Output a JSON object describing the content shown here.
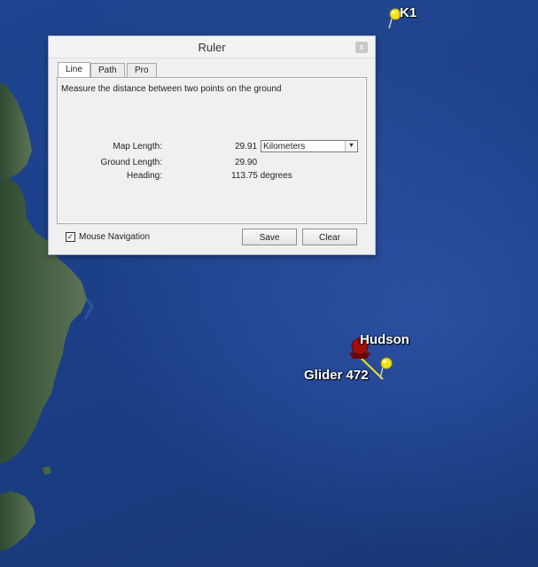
{
  "map": {
    "placemarks": [
      {
        "name": "K1",
        "icon": "yellow-pushpin-icon"
      },
      {
        "name": "Hudson",
        "icon": "red-ship-icon"
      },
      {
        "name": "Glider 472",
        "icon": "yellow-pushpin-icon"
      }
    ],
    "colors": {
      "ocean": "#1c3f88",
      "land": "#3c5a3a",
      "pin": "#f2e21a",
      "ship": "#a30f0f",
      "ruler_line": "#f2e21a"
    }
  },
  "ruler": {
    "title": "Ruler",
    "close_label": "x",
    "tabs": [
      {
        "label": "Line",
        "active": true
      },
      {
        "label": "Path",
        "active": false
      },
      {
        "label": "Pro",
        "active": false
      }
    ],
    "description": "Measure the distance between two points on the ground",
    "map_length": {
      "label": "Map Length:",
      "value": "29.91"
    },
    "unit_select": {
      "value": "Kilometers",
      "icon": "chevron-down-icon"
    },
    "ground_length": {
      "label": "Ground Length:",
      "value": "29.90"
    },
    "heading": {
      "label": "Heading:",
      "value": "113.75 degrees"
    },
    "mouse_navigation": {
      "label": "Mouse Navigation",
      "checked": true,
      "check_mark": "✓"
    },
    "save_label": "Save",
    "clear_label": "Clear"
  }
}
